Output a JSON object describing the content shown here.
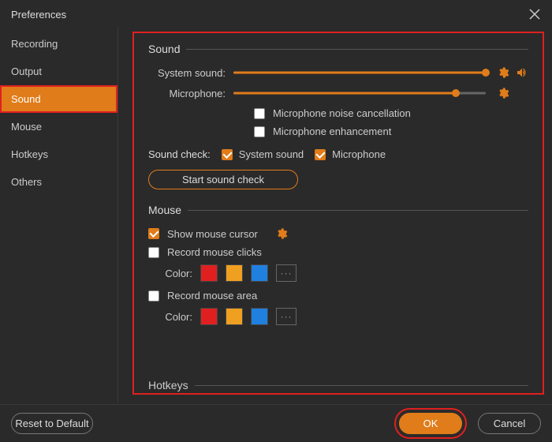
{
  "window": {
    "title": "Preferences"
  },
  "sidebar": {
    "items": [
      {
        "label": "Recording",
        "active": false
      },
      {
        "label": "Output",
        "active": false
      },
      {
        "label": "Sound",
        "active": true
      },
      {
        "label": "Mouse",
        "active": false
      },
      {
        "label": "Hotkeys",
        "active": false
      },
      {
        "label": "Others",
        "active": false
      }
    ]
  },
  "sound": {
    "heading": "Sound",
    "system_sound_label": "System sound:",
    "system_sound_pct": 100,
    "microphone_label": "Microphone:",
    "microphone_pct": 88,
    "noise_cancel": {
      "checked": false,
      "label": "Microphone noise cancellation"
    },
    "mic_enhance": {
      "checked": false,
      "label": "Microphone enhancement"
    },
    "sound_check_label": "Sound check:",
    "sc_system": {
      "checked": true,
      "label": "System sound"
    },
    "sc_mic": {
      "checked": true,
      "label": "Microphone"
    },
    "start_button": "Start sound check"
  },
  "mouse": {
    "heading": "Mouse",
    "show_cursor": {
      "checked": true,
      "label": "Show mouse cursor"
    },
    "record_clicks": {
      "checked": false,
      "label": "Record mouse clicks"
    },
    "color_label": "Color:",
    "click_colors": [
      "#e02020",
      "#f0a020",
      "#2080e0"
    ],
    "record_area": {
      "checked": false,
      "label": "Record mouse area"
    },
    "area_colors": [
      "#e02020",
      "#f0a020",
      "#2080e0"
    ],
    "more": "···"
  },
  "hotkeys_peek": "Hotkeys",
  "footer": {
    "reset": "Reset to Default",
    "ok": "OK",
    "cancel": "Cancel"
  }
}
